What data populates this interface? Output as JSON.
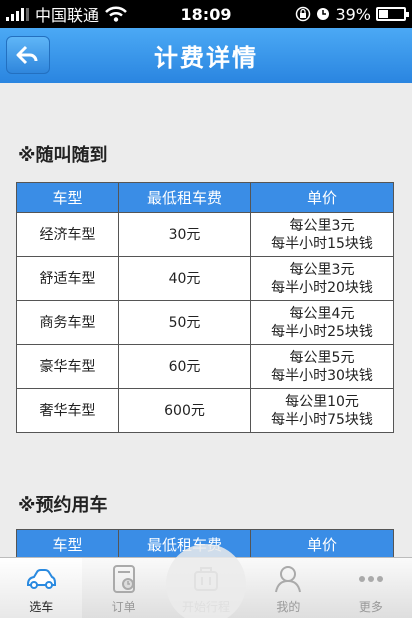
{
  "status_bar": {
    "carrier": "中国联通",
    "time": "18:09",
    "battery": "39%"
  },
  "header": {
    "title": "计费详情"
  },
  "sections": [
    {
      "title": "※随叫随到",
      "columns": [
        "车型",
        "最低租车费",
        "单价"
      ],
      "rows": [
        {
          "type": "经济车型",
          "min_fee": "30元",
          "price_line1": "每公里3元",
          "price_line2": "每半小时15块钱"
        },
        {
          "type": "舒适车型",
          "min_fee": "40元",
          "price_line1": "每公里3元",
          "price_line2": "每半小时20块钱"
        },
        {
          "type": "商务车型",
          "min_fee": "50元",
          "price_line1": "每公里4元",
          "price_line2": "每半小时25块钱"
        },
        {
          "type": "豪华车型",
          "min_fee": "60元",
          "price_line1": "每公里5元",
          "price_line2": "每半小时30块钱"
        },
        {
          "type": "奢华车型",
          "min_fee": "600元",
          "price_line1": "每公里10元",
          "price_line2": "每半小时75块钱"
        }
      ]
    },
    {
      "title": "※预约用车",
      "columns": [
        "车型",
        "最低租车费",
        "单价"
      ]
    }
  ],
  "tab_bar": {
    "items": [
      {
        "label": "选车",
        "icon": "car-icon",
        "active": true
      },
      {
        "label": "订单",
        "icon": "order-icon",
        "active": false
      },
      {
        "label": "开始行程",
        "icon": "trip-icon",
        "active": false
      },
      {
        "label": "我的",
        "icon": "user-icon",
        "active": false
      },
      {
        "label": "更多",
        "icon": "more-icon",
        "active": false
      }
    ]
  },
  "colors": {
    "nav_blue": "#2a85e0",
    "table_header": "#3a8de6",
    "active_tab_icon": "#2a8ae0"
  }
}
